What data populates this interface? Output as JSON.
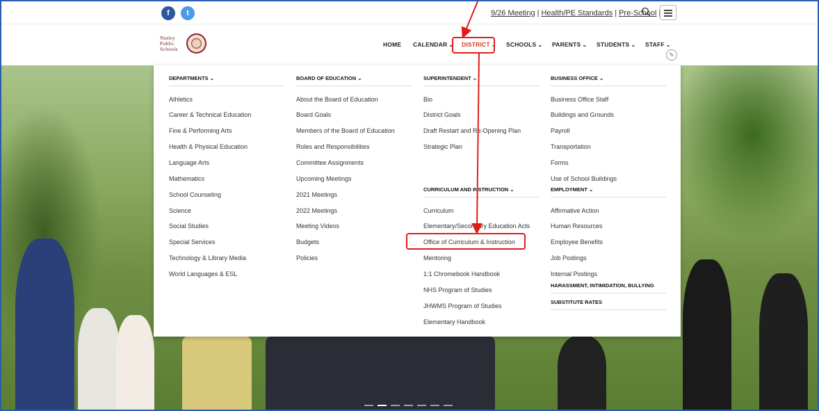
{
  "topbar": {
    "social": [
      {
        "icon": "facebook-icon",
        "glyph": "f"
      },
      {
        "icon": "twitter-icon",
        "glyph": "t"
      }
    ],
    "links": [
      "9/26 Meeting",
      "Health/PE Standards",
      "Pre-School"
    ],
    "separator": "|"
  },
  "logo": {
    "line1": "Nutley",
    "line2": "Public",
    "line3": "Schools"
  },
  "nav": {
    "home": "HOME",
    "calendar": "CALENDAR",
    "district": "DISTRICT",
    "schools": "SCHOOLS",
    "parents": "PARENTS",
    "students": "STUDENTS",
    "staff": "STAFF",
    "chevron": "⌄"
  },
  "mega_menu": {
    "departments": {
      "heading": "DEPARTMENTS ⌄",
      "items": [
        "Athletics",
        "Career & Technical Education",
        "Fine & Performing Arts",
        "Health & Physical Education",
        "Language Arts",
        "Mathematics",
        "School Counseling",
        "Science",
        "Social Studies",
        "Special Services",
        "Technology & Library Media",
        "World Languages & ESL"
      ]
    },
    "board": {
      "heading": "BOARD OF EDUCATION ⌄",
      "items": [
        "About the Board of Education",
        "Board Goals",
        "Members of the Board of Education",
        "Roles and Responsibilities",
        "Committee Assignments",
        "Upcoming Meetings",
        "2021 Meetings",
        "2022 Meetings",
        "Meeting Videos",
        "Budgets",
        "Policies"
      ]
    },
    "superintendent": {
      "heading": "SUPERINTENDENT ⌄",
      "items": [
        "Bio",
        "District Goals",
        "Draft Restart and Re-Opening Plan",
        "Strategic Plan"
      ]
    },
    "curriculum": {
      "heading": "CURRICULUM AND INSTRUCTION ⌄",
      "items": [
        "Curriculum",
        "Elementary/Secondary Education Acts",
        "Office of Curriculum & Instruction",
        "Mentoring",
        "1:1 Chromebook Handbook",
        "NHS Program of Studies",
        "JHWMS Program of Studies",
        "Elementary Handbook"
      ]
    },
    "business": {
      "heading": "BUSINESS OFFICE ⌄",
      "items": [
        "Business Office Staff",
        "Buildings and Grounds",
        "Payroll",
        "Transportation",
        "Forms",
        "Use of School Buildings"
      ]
    },
    "employment": {
      "heading": "EMPLOYMENT ⌄",
      "items": [
        "Affirmative Action",
        "Human Resources",
        "Employee Benefits",
        "Job Postings",
        "Internal Postings"
      ]
    },
    "harassment": {
      "heading": "HARASSMENT, INTIMIDATION, BULLYING"
    },
    "substitute": {
      "heading": "SUBSTITUTE RATES"
    }
  },
  "colors": {
    "accent_red": "#e01b1b",
    "nav_active": "#d33a1a",
    "border_blue": "#2a5db0"
  }
}
